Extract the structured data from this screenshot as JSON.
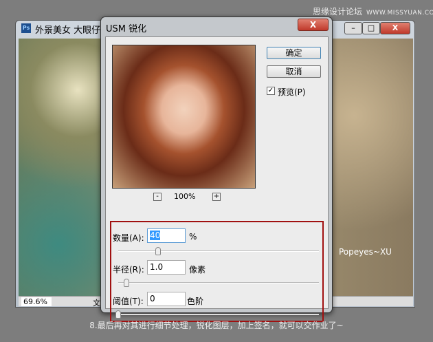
{
  "watermark": {
    "site": "思缘设计论坛",
    "url": "WWW.MISSYUAN.COM"
  },
  "document_window": {
    "app_icon": "Ps",
    "title": "外景美女 大眼仔",
    "zoom": "69.6%",
    "status_fragment": "文",
    "signature": "Popeyes~XU",
    "min_label": "–",
    "max_label": "□",
    "close_label": "X"
  },
  "dialog": {
    "title": "USM 锐化",
    "close_label": "X",
    "ok_label": "确定",
    "cancel_label": "取消",
    "preview_label": "预览(P)",
    "preview_checked": true,
    "zoom_level": "100%",
    "zoom_out": "-",
    "zoom_in": "+",
    "amount": {
      "label": "数量(A):",
      "value": "40",
      "unit": "%",
      "slider_fraction": 0.2
    },
    "radius": {
      "label": "半径(R):",
      "value": "1.0",
      "unit": "像素",
      "slider_fraction": 0.04
    },
    "threshold": {
      "label": "阈值(T):",
      "value": "0",
      "unit": "色阶",
      "slider_fraction": 0.0
    },
    "highlight_color": "#a01010"
  },
  "caption": "8.最后再对其进行细节处理，锐化图层，加上签名，就可以交作业了~"
}
